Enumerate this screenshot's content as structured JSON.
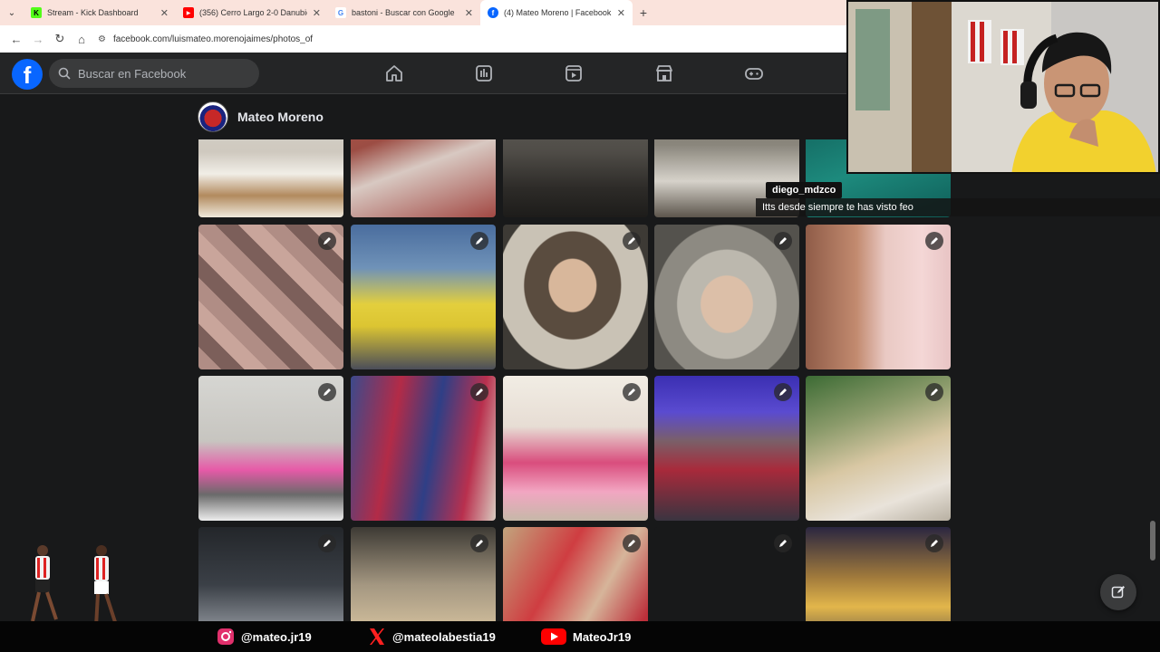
{
  "browser": {
    "tabs": [
      {
        "title": "Stream - Kick Dashboard",
        "favicon_color": "#53fc18",
        "favicon_letter": "K",
        "active": false
      },
      {
        "title": "(356) Cerro Largo 2-0 Danubio",
        "favicon_color": "#ff0000",
        "favicon_letter": "▶",
        "active": false
      },
      {
        "title": "bastoni - Buscar con Google",
        "favicon_color": "#4285f4",
        "favicon_letter": "G",
        "active": false
      },
      {
        "title": "(4) Mateo Moreno | Facebook",
        "favicon_color": "#0866ff",
        "favicon_letter": "f",
        "active": true
      }
    ],
    "url": "facebook.com/luismateo.morenojaimes/photos_of"
  },
  "facebook": {
    "search_placeholder": "Buscar en Facebook",
    "nav_icons": [
      "home-icon",
      "feed-icon",
      "video-icon",
      "marketplace-icon",
      "gaming-icon"
    ],
    "profile_name": "Mateo Moreno"
  },
  "photos": {
    "rows": [
      [
        "party-table-cake",
        "kids-party-floor",
        "birthday-table-dark",
        "party-table-cake-2",
        "green-wall-post"
      ],
      [
        "selfie-collage",
        "family-colombia-jerseys",
        "baby-sombrero",
        "baby-sombrero-closeup",
        "man-with-baby"
      ],
      [
        "balloons-birthday",
        "neymar-messi-barcelona",
        "pink-birthday-party",
        "family-group-indoor",
        "patio-gathering"
      ],
      [
        "night-gathering-fence",
        "group-dinner",
        "group-selfie-pink",
        "empty-photo",
        "night-gathering-lights"
      ]
    ]
  },
  "stream": {
    "chat_user": "diego_mdzco",
    "chat_message": "Itts desde siempre te has visto feo",
    "socials": [
      {
        "platform": "instagram",
        "handle": "@mateo.jr19",
        "color": "#e1306c"
      },
      {
        "platform": "x",
        "handle": "@mateolabestia19",
        "color": "#ff2020"
      },
      {
        "platform": "youtube",
        "handle": "MateoJr19",
        "color": "#ff0000"
      }
    ]
  }
}
